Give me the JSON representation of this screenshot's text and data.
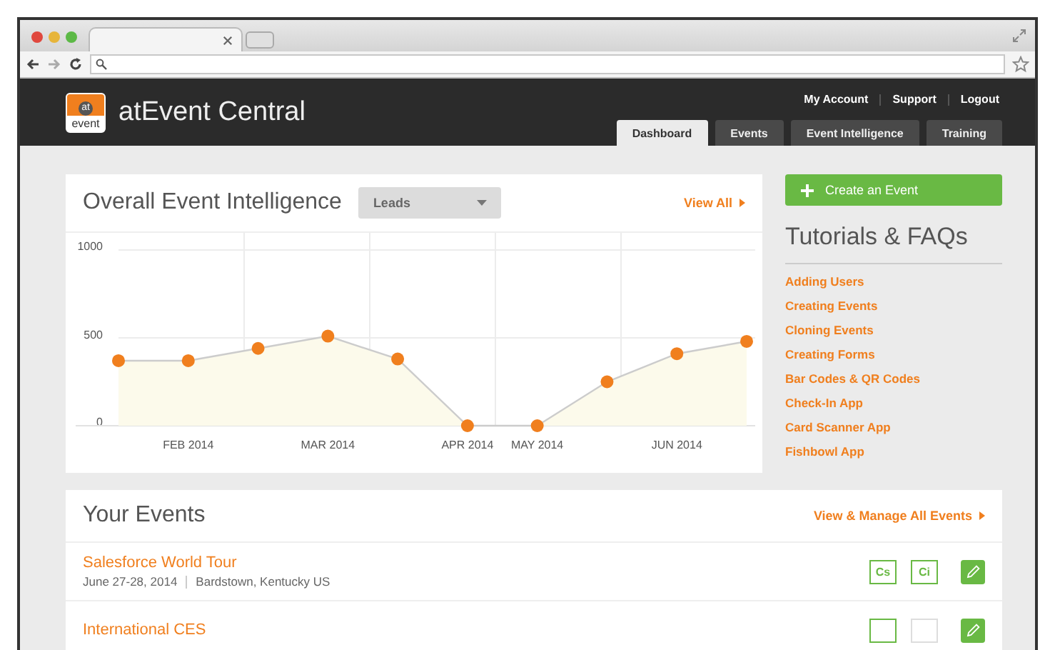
{
  "app": {
    "title": "atEvent Central",
    "logo_top": "at",
    "logo_bottom": "event"
  },
  "account_links": [
    "My Account",
    "Support",
    "Logout"
  ],
  "tabs": [
    {
      "label": "Dashboard",
      "selected": true
    },
    {
      "label": "Events",
      "selected": false
    },
    {
      "label": "Event Intelligence",
      "selected": false
    },
    {
      "label": "Training",
      "selected": false
    }
  ],
  "intelligence": {
    "title": "Overall Event Intelligence",
    "view_all": "View All",
    "chart_data": {
      "type": "area",
      "categories": [
        null,
        "FEB 2014",
        null,
        "MAR 2014",
        null,
        "APR 2014",
        "MAY 2014",
        null,
        "JUN 2014",
        null
      ],
      "series": [
        {
          "name": "Leads",
          "color": "#f07f1e",
          "values": [
            370,
            370,
            440,
            510,
            380,
            0,
            0,
            250,
            410,
            480
          ]
        }
      ],
      "ylim": [
        0,
        1000
      ],
      "yticks": [
        0,
        500,
        1000
      ]
    }
  },
  "create_button": "Create an Event",
  "tutorials": {
    "title": "Tutorials & FAQs",
    "links": [
      "Adding Users",
      "Creating Events",
      "Cloning Events",
      "Creating Forms",
      "Bar Codes & QR Codes",
      "Check-In App",
      "Card Scanner App",
      "Fishbowl App"
    ]
  },
  "events": {
    "title": "Your Events",
    "manage": "View & Manage All Events",
    "rows": [
      {
        "name": "Salesforce World Tour",
        "date": "June 27-28, 2014",
        "place": "Bardstown, Kentucky US",
        "badges": [
          {
            "label": "Cs",
            "active": true
          },
          {
            "label": "Ci",
            "active": true
          }
        ]
      },
      {
        "name": "International CES",
        "badges": [
          {
            "active": true
          },
          {
            "active": false
          }
        ]
      }
    ]
  }
}
